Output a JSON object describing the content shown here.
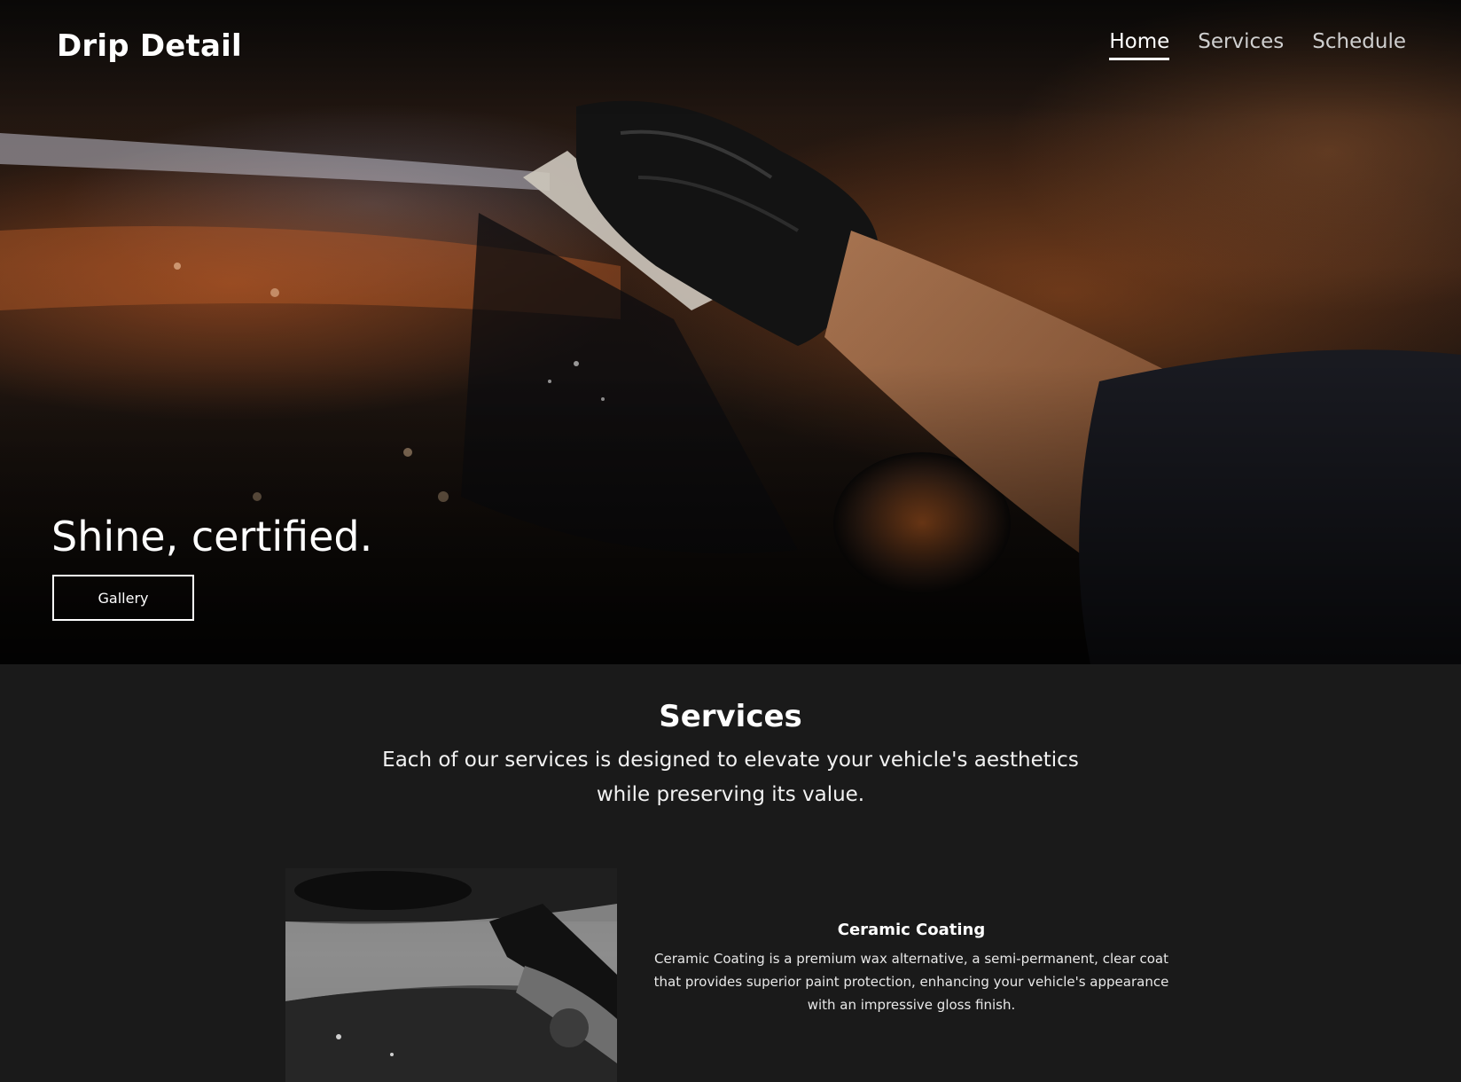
{
  "nav": {
    "brand": "Drip Detail",
    "links": [
      {
        "label": "Home",
        "active": true
      },
      {
        "label": "Services",
        "active": false
      },
      {
        "label": "Schedule",
        "active": false
      }
    ]
  },
  "hero": {
    "title": "Shine, certified.",
    "button_label": "Gallery"
  },
  "services": {
    "title": "Services",
    "subtitle": "Each of our services is designed to elevate your vehicle's aesthetics while preserving its value.",
    "items": [
      {
        "name": "Ceramic Coating",
        "description": "Ceramic Coating is a premium wax alternative, a semi-permanent, clear coat that provides superior paint protection, enhancing your vehicle's appearance with an impressive gloss finish."
      }
    ]
  },
  "colors": {
    "page_background": "#1a1a1a",
    "text": "#ffffff",
    "accent_orange": "#c0652a"
  }
}
